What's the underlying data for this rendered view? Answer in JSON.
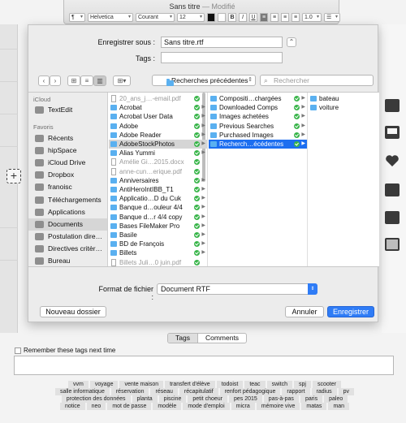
{
  "window": {
    "title": "Sans titre",
    "modified": " — Modifié"
  },
  "format_bar": {
    "paragraph_style": "¶",
    "font_family": "Helvetica",
    "font_style": "Courant",
    "font_size": "12",
    "bold": "B",
    "italic": "I",
    "underline": "U",
    "line_spacing": "1.0"
  },
  "dialog": {
    "save_as_label": "Enregistrer sous :",
    "save_as_value": "Sans titre.rtf",
    "tags_label": "Tags :",
    "tags_value": "",
    "location": "Recherches précédentes",
    "search_placeholder": "Rechercher",
    "format_label": "Format de fichier :",
    "format_value": "Document RTF",
    "new_folder": "Nouveau dossier",
    "cancel": "Annuler",
    "save": "Enregistrer"
  },
  "sidebar": {
    "icloud_header": "iCloud",
    "icloud_items": [
      "TextEdit"
    ],
    "favorites_header": "Favoris",
    "favorites": [
      "Récents",
      "hipSpace",
      "iCloud Drive",
      "Dropbox",
      "franoisc",
      "Téléchargements",
      "Applications",
      "Documents",
      "Postulation dire…",
      "Directives critèr…",
      "Bureau"
    ]
  },
  "column1": [
    {
      "name": "20_ans_j…-email.pdf",
      "kind": "doc",
      "dim": true
    },
    {
      "name": "Acrobat",
      "kind": "folder"
    },
    {
      "name": "Acrobat User Data",
      "kind": "folder"
    },
    {
      "name": "Adobe",
      "kind": "folder"
    },
    {
      "name": "Adobe Reader",
      "kind": "folder"
    },
    {
      "name": "AdobeStockPhotos",
      "kind": "folder",
      "hl": true
    },
    {
      "name": "Alias Yummi",
      "kind": "folder"
    },
    {
      "name": "Amélie Gi…2015.docx",
      "kind": "doc",
      "dim": true
    },
    {
      "name": "anne-cun…erique.pdf",
      "kind": "doc",
      "dim": true
    },
    {
      "name": "Anniversaires",
      "kind": "folder"
    },
    {
      "name": "AntiHeroIntIBB_T1",
      "kind": "folder"
    },
    {
      "name": "Applicatio…D du Cuk",
      "kind": "folder"
    },
    {
      "name": "Banque d…ouleur 4/4",
      "kind": "folder"
    },
    {
      "name": "Banque d…r 4/4 copy",
      "kind": "folder"
    },
    {
      "name": "Bases FileMaker Pro",
      "kind": "folder"
    },
    {
      "name": "Basile",
      "kind": "folder"
    },
    {
      "name": "BD de François",
      "kind": "folder"
    },
    {
      "name": "Billets",
      "kind": "folder"
    },
    {
      "name": "Billets Juli…0 juin.pdf",
      "kind": "doc",
      "dim": true
    }
  ],
  "column2": [
    {
      "name": "Compositi…chargées",
      "kind": "folder"
    },
    {
      "name": "Downloaded Comps",
      "kind": "folder"
    },
    {
      "name": "Images achetées",
      "kind": "folder"
    },
    {
      "name": "Previous Searches",
      "kind": "folder"
    },
    {
      "name": "Purchased Images",
      "kind": "folder"
    },
    {
      "name": "Recherch…écédentes",
      "kind": "folder",
      "active": true
    }
  ],
  "column3": [
    {
      "name": "bateau",
      "kind": "folder"
    },
    {
      "name": "voiture",
      "kind": "folder"
    }
  ],
  "tags_panel": {
    "tab_tags": "Tags",
    "tab_comments": "Comments",
    "remember": "Remember these tags next time",
    "cloud_rows": [
      [
        "vvm",
        "voyage",
        "vente maison",
        "transfert d'élève",
        "todoist",
        "teac",
        "switch",
        "spj",
        "scooter"
      ],
      [
        "salle informatique",
        "réservation",
        "réseau",
        "récapitulatif",
        "renfort pédagogique",
        "rapport",
        "radius",
        "pv"
      ],
      [
        "protection des données",
        "planta",
        "piscine",
        "petit choeur",
        "pes 2015",
        "pas-à-pas",
        "paris",
        "paleo"
      ],
      [
        "notice",
        "neo",
        "mot de passe",
        "modèle",
        "mode d'emploi",
        "micra",
        "mémoire vive",
        "matas",
        "man"
      ]
    ]
  }
}
